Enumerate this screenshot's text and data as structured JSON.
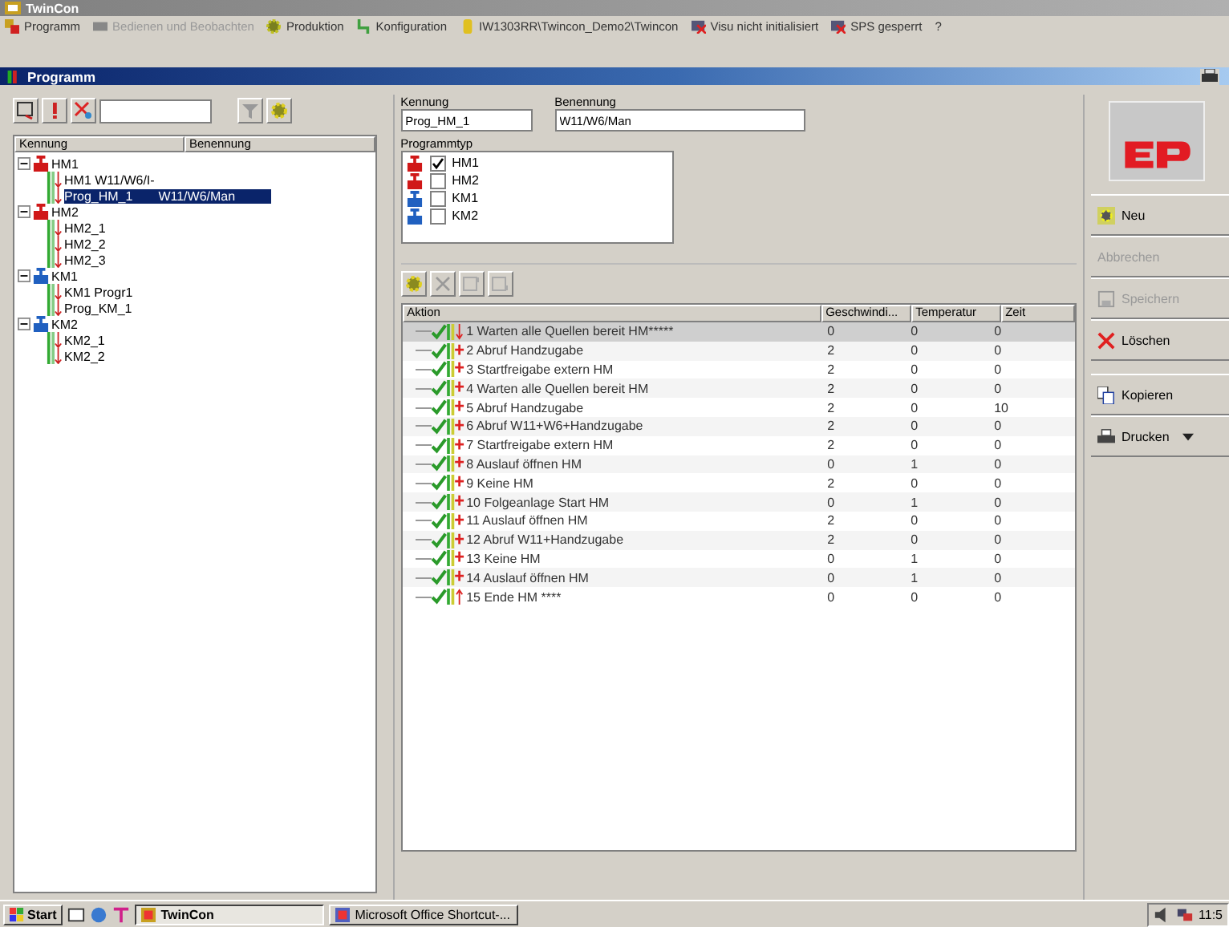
{
  "window": {
    "title": "TwinCon"
  },
  "menu": [
    {
      "label": "Programm",
      "disabled": false,
      "kind": "prog"
    },
    {
      "label": "Bedienen und Beobachten",
      "disabled": true,
      "kind": "monitor"
    },
    {
      "label": "Produktion",
      "disabled": false,
      "kind": "gear"
    },
    {
      "label": "Konfiguration",
      "disabled": false,
      "kind": "config"
    },
    {
      "label": "IW1303RR\\Twincon_Demo2\\Twincon",
      "disabled": false,
      "kind": "db"
    },
    {
      "label": "Visu nicht initialisiert",
      "disabled": false,
      "kind": "visu"
    },
    {
      "label": "SPS gesperrt",
      "disabled": false,
      "kind": "sps"
    },
    {
      "label": "?",
      "disabled": false,
      "kind": "none"
    }
  ],
  "panel": {
    "title": "Programm"
  },
  "tree": {
    "columns": [
      "Kennung",
      "Benennung"
    ],
    "children": [
      {
        "label": "HM1",
        "color": "#d01818",
        "expanded": true,
        "children": [
          {
            "label": "HM1 W11/W6/I-",
            "selected": false
          },
          {
            "label": "Prog_HM_1",
            "description": "W11/W6/Man",
            "selected": true
          }
        ]
      },
      {
        "label": "HM2",
        "color": "#d01818",
        "expanded": true,
        "children": [
          {
            "label": "HM2_1",
            "selected": false
          },
          {
            "label": "HM2_2",
            "selected": false
          },
          {
            "label": "HM2_3",
            "selected": false
          }
        ]
      },
      {
        "label": "KM1",
        "color": "#2060c0",
        "expanded": true,
        "children": [
          {
            "label": "KM1 Progr1",
            "selected": false
          },
          {
            "label": "Prog_KM_1",
            "selected": false
          }
        ]
      },
      {
        "label": "KM2",
        "color": "#2060c0",
        "expanded": true,
        "children": [
          {
            "label": "KM2_1",
            "selected": false
          },
          {
            "label": "KM2_2",
            "selected": false
          }
        ]
      }
    ]
  },
  "form": {
    "kennung_label": "Kennung",
    "kennung": "Prog_HM_1",
    "benennung_label": "Benennung",
    "benennung": "W11/W6/Man",
    "typ_label": "Programmtyp",
    "types": [
      {
        "label": "HM1",
        "checked": true,
        "color": "#d01818"
      },
      {
        "label": "HM2",
        "checked": false,
        "color": "#d01818"
      },
      {
        "label": "KM1",
        "checked": false,
        "color": "#2060c0"
      },
      {
        "label": "KM2",
        "checked": false,
        "color": "#2060c0"
      }
    ]
  },
  "table": {
    "columns": [
      "Aktion",
      "Geschwindi...",
      "Temperatur",
      "Zeit"
    ],
    "rows": [
      {
        "kind": "start",
        "selected": true,
        "cells": [
          "1 Warten alle Quellen bereit HM*****",
          "0",
          "0",
          "0"
        ]
      },
      {
        "kind": "step",
        "selected": false,
        "cells": [
          "2 Abruf Handzugabe",
          "2",
          "0",
          "0"
        ]
      },
      {
        "kind": "step",
        "selected": false,
        "cells": [
          "3 Startfreigabe extern HM",
          "2",
          "0",
          "0"
        ]
      },
      {
        "kind": "step",
        "selected": false,
        "cells": [
          "4 Warten alle Quellen bereit HM",
          "2",
          "0",
          "0"
        ]
      },
      {
        "kind": "step",
        "selected": false,
        "cells": [
          "5 Abruf Handzugabe",
          "2",
          "0",
          "10"
        ]
      },
      {
        "kind": "step",
        "selected": false,
        "cells": [
          "6 Abruf W11+W6+Handzugabe",
          "2",
          "0",
          "0"
        ]
      },
      {
        "kind": "step",
        "selected": false,
        "cells": [
          "7 Startfreigabe extern HM",
          "2",
          "0",
          "0"
        ]
      },
      {
        "kind": "step",
        "selected": false,
        "cells": [
          "8 Auslauf öffnen HM",
          "0",
          "1",
          "0"
        ]
      },
      {
        "kind": "step",
        "selected": false,
        "cells": [
          "9 Keine HM",
          "2",
          "0",
          "0"
        ]
      },
      {
        "kind": "step",
        "selected": false,
        "cells": [
          "10 Folgeanlage Start HM",
          "0",
          "1",
          "0"
        ]
      },
      {
        "kind": "step",
        "selected": false,
        "cells": [
          "11 Auslauf öffnen HM",
          "2",
          "0",
          "0"
        ]
      },
      {
        "kind": "step",
        "selected": false,
        "cells": [
          "12 Abruf W11+Handzugabe",
          "2",
          "0",
          "0"
        ]
      },
      {
        "kind": "step",
        "selected": false,
        "cells": [
          "13 Keine HM",
          "0",
          "1",
          "0"
        ]
      },
      {
        "kind": "step",
        "selected": false,
        "cells": [
          "14 Auslauf öffnen HM",
          "0",
          "1",
          "0"
        ]
      },
      {
        "kind": "end",
        "selected": false,
        "cells": [
          "15 Ende HM ****",
          "0",
          "0",
          "0"
        ]
      }
    ]
  },
  "actions": [
    {
      "label": "Neu",
      "disabled": false,
      "kind": "new"
    },
    {
      "label": "Abbrechen",
      "disabled": true,
      "kind": "none"
    },
    {
      "label": "Speichern",
      "disabled": true,
      "kind": "save"
    },
    {
      "label": "Löschen",
      "disabled": false,
      "kind": "delete"
    },
    {
      "label": "Kopieren",
      "disabled": false,
      "kind": "copy"
    },
    {
      "label": "Drucken",
      "disabled": false,
      "kind": "print"
    }
  ],
  "taskbar": {
    "start": "Start",
    "tasks": [
      {
        "label": "TwinCon",
        "selected": true
      },
      {
        "label": "Microsoft Office Shortcut-...",
        "selected": false
      }
    ],
    "clock": "11:5"
  }
}
